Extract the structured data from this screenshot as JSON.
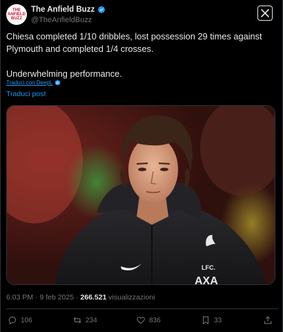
{
  "account": {
    "name": "The Anfield Buzz",
    "handle": "@TheAnfieldBuzz",
    "avatar_text": "THE ANFIELD BUZZ"
  },
  "tweet": {
    "line1": "Chiesa completed 1/10 dribbles, lost possession 29 times against",
    "line2": "Plymouth and completed 1/4 crosses.",
    "line3": "Underwhelming performance.",
    "translated_by": "Traduci con DeepL",
    "translate_post": "Traduci post"
  },
  "meta": {
    "time": "6:03 PM · 9 feb 2025 · ",
    "views_count": "266.521",
    "views_label": " visualizzazioni"
  },
  "actions": {
    "replies": "106",
    "reposts": "234",
    "likes": "836",
    "bookmarks": "33"
  },
  "photo": {
    "badge_text": "LFC.",
    "sponsor_text": "AXA"
  },
  "colors": {
    "accent": "#1d9bf0",
    "muted": "#71767b",
    "background": "#000000"
  }
}
